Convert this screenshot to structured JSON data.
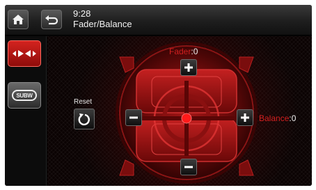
{
  "header": {
    "time": "9:28",
    "title": "Fader/Balance",
    "home_icon": "home-icon",
    "back_icon": "back-arrow-icon"
  },
  "sidebar": {
    "items": [
      {
        "name": "fader-balance",
        "icon": "fader-balance-arrows-icon",
        "selected": true
      },
      {
        "name": "subwoofer",
        "icon": "subwoofer-icon",
        "label": "SUBW",
        "selected": false
      }
    ]
  },
  "controls": {
    "reset_label": "Reset",
    "fader": {
      "label": "Fader",
      "separator": ":",
      "value": "0"
    },
    "balance": {
      "label": "Balance",
      "separator": ":",
      "value": "0"
    }
  },
  "colors": {
    "accent": "#d21f1f",
    "background": "#0b0303",
    "topbar": "#2a2a2a"
  }
}
